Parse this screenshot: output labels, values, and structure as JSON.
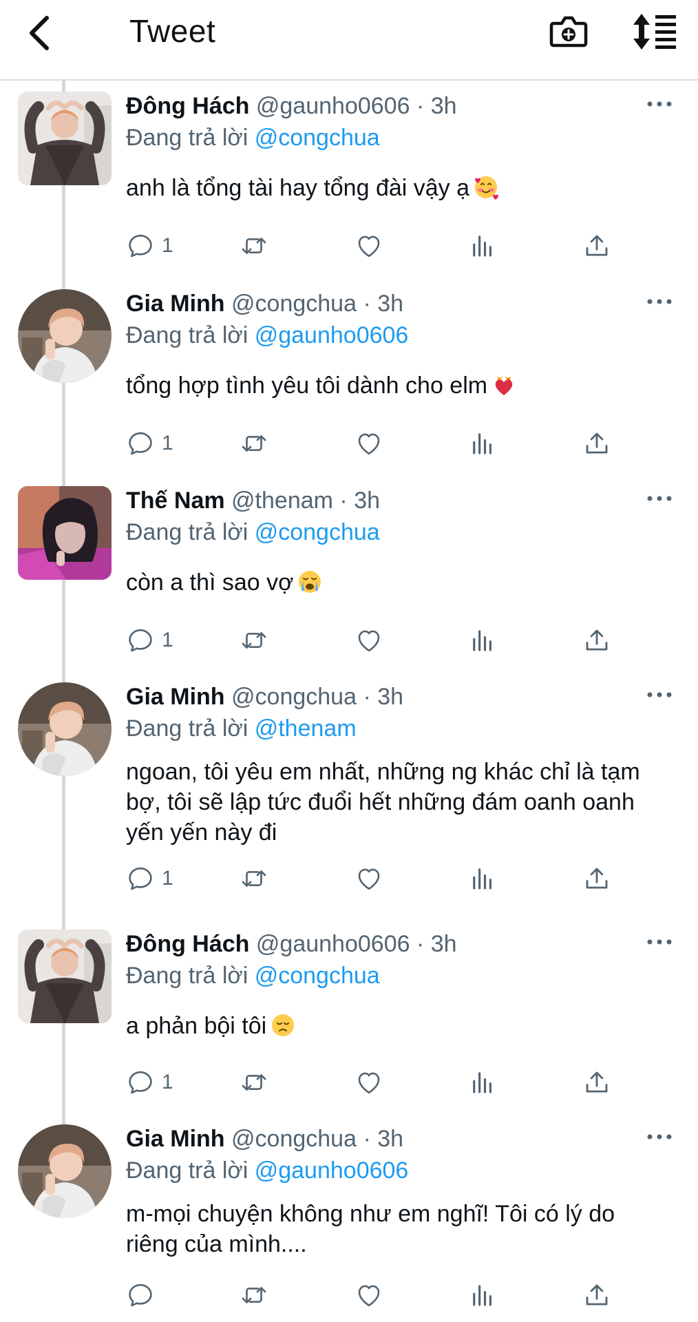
{
  "header": {
    "title": "Tweet",
    "back_icon": "chevron-left-icon",
    "camera_icon": "camera-plus-icon",
    "sort_icon": "sort-list-icon"
  },
  "colors": {
    "link": "#1d9bf0",
    "secondary_text": "#536471",
    "thread_line": "#cfd9de"
  },
  "tweets": [
    {
      "name": "Đông Hách",
      "handle": "@gaunho0606",
      "sep": "·",
      "time": "3h",
      "replying_prefix": "Đang trả lời",
      "replying_to": "@congchua",
      "text": "anh là tổng tài hay tổng đài vậy ạ",
      "emoji": "smiling-face-with-hearts",
      "reply_count": "1"
    },
    {
      "name": "Gia Minh",
      "handle": "@congchua",
      "sep": "·",
      "time": "3h",
      "replying_prefix": "Đang trả lời",
      "replying_to": "@gaunho0606",
      "text": "tổng hợp tình yêu tôi dành cho elm",
      "emoji": "heart-on-fire",
      "reply_count": "1"
    },
    {
      "name": "Thế Nam",
      "handle": "@thenam",
      "sep": "·",
      "time": "3h",
      "replying_prefix": "Đang trả lời",
      "replying_to": "@congchua",
      "text": "còn a thì sao vợ",
      "emoji": "loudly-crying-face",
      "reply_count": "1"
    },
    {
      "name": "Gia Minh",
      "handle": "@congchua",
      "sep": "·",
      "time": "3h",
      "replying_prefix": "Đang trả lời",
      "replying_to": "@thenam",
      "text": "ngoan, tôi yêu em nhất, những ng khác chỉ là tạm bợ, tôi sẽ lập tức đuổi hết những đám oanh oanh yến yến này đi",
      "emoji": "",
      "reply_count": "1"
    },
    {
      "name": "Đông Hách",
      "handle": "@gaunho0606",
      "sep": "·",
      "time": "3h",
      "replying_prefix": "Đang trả lời",
      "replying_to": "@congchua",
      "text": "a phản bội tôi",
      "emoji": "disappointed-face",
      "reply_count": "1"
    },
    {
      "name": "Gia Minh",
      "handle": "@congchua",
      "sep": "·",
      "time": "3h",
      "replying_prefix": "Đang trả lời",
      "replying_to": "@gaunho0606",
      "text": "m-mọi chuyện không như em nghĩ! Tôi có lý do riêng của mình....",
      "emoji": "",
      "reply_count": ""
    }
  ]
}
